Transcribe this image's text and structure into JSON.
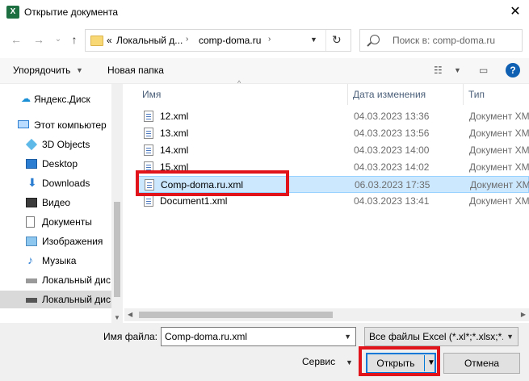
{
  "window": {
    "title": "Открытие документа",
    "app_icon": "X"
  },
  "nav": {
    "back": "←",
    "forward": "→",
    "recent": "⌄",
    "up": "↑",
    "crumbs": [
      "«",
      "Локальный д...",
      "›",
      "comp-doma.ru",
      "›"
    ],
    "search_placeholder": "Поиск в: comp-doma.ru"
  },
  "toolbar": {
    "organize": "Упорядочить",
    "new_folder": "Новая папка"
  },
  "sidebar": {
    "items": [
      {
        "label": "Яндекс.Диск",
        "icon": "cloud-icon"
      },
      {
        "label": "Этот компьютер",
        "icon": "computer-icon"
      },
      {
        "label": "3D Objects",
        "icon": "cube-icon"
      },
      {
        "label": "Desktop",
        "icon": "desktop-icon"
      },
      {
        "label": "Downloads",
        "icon": "download-icon"
      },
      {
        "label": "Видео",
        "icon": "video-icon"
      },
      {
        "label": "Документы",
        "icon": "documents-icon"
      },
      {
        "label": "Изображения",
        "icon": "pictures-icon"
      },
      {
        "label": "Музыка",
        "icon": "music-icon"
      },
      {
        "label": "Локальный дис",
        "icon": "drive-icon"
      },
      {
        "label": "Локальный дис",
        "icon": "drive-icon"
      }
    ]
  },
  "filelist": {
    "columns": {
      "name": "Имя",
      "date": "Дата изменения",
      "type": "Тип"
    },
    "rows": [
      {
        "name": "12.xml",
        "date": "04.03.2023 13:36",
        "type": "Документ XML"
      },
      {
        "name": "13.xml",
        "date": "04.03.2023 13:56",
        "type": "Документ XML"
      },
      {
        "name": "14.xml",
        "date": "04.03.2023 14:00",
        "type": "Документ XML"
      },
      {
        "name": "15.xml",
        "date": "04.03.2023 14:02",
        "type": "Документ XML"
      },
      {
        "name": "Comp-doma.ru.xml",
        "date": "06.03.2023 17:35",
        "type": "Документ XML"
      },
      {
        "name": "Document1.xml",
        "date": "04.03.2023 13:41",
        "type": "Документ XML"
      }
    ]
  },
  "bottom": {
    "filename_label": "Имя файла:",
    "filename_value": "Comp-doma.ru.xml",
    "filter": "Все файлы Excel (*.xl*;*.xlsx;*.x",
    "tools": "Сервис",
    "open": "Открыть",
    "cancel": "Отмена"
  },
  "colors": {
    "highlight": "#e0141a",
    "selection": "#cce8ff",
    "accent": "#0078d7"
  }
}
